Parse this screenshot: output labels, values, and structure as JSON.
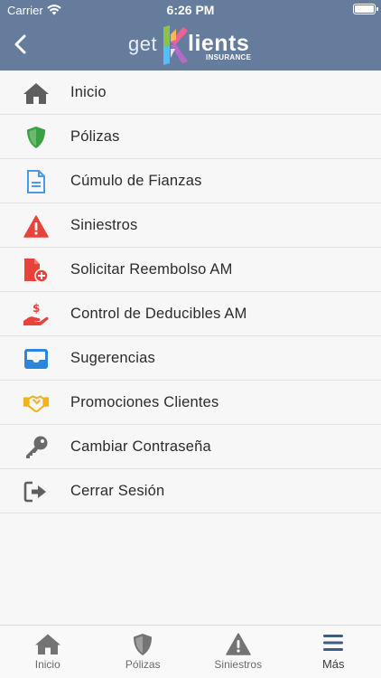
{
  "status_bar": {
    "carrier": "Carrier",
    "time": "6:26 PM"
  },
  "header": {
    "back_icon": "chevron-left-icon",
    "logo": {
      "prefix": "get",
      "brand": "lients",
      "tagline": "INSURANCE"
    }
  },
  "menu": {
    "items": [
      {
        "label": "Inicio",
        "icon": "home-icon",
        "color": "#5f5f5f"
      },
      {
        "label": "Pólizas",
        "icon": "shield-icon",
        "color": "#3aa142"
      },
      {
        "label": "Cúmulo de Fianzas",
        "icon": "document-icon",
        "color": "#4a9be3"
      },
      {
        "label": "Siniestros",
        "icon": "warning-icon",
        "color": "#e8433b"
      },
      {
        "label": "Solicitar Reembolso AM",
        "icon": "file-add-icon",
        "color": "#e8433b"
      },
      {
        "label": "Control de Deducibles AM",
        "icon": "hand-dollar-icon",
        "color": "#e8433b"
      },
      {
        "label": "Sugerencias",
        "icon": "inbox-icon",
        "color": "#2a86d8"
      },
      {
        "label": "Promociones Clientes",
        "icon": "handshake-icon",
        "color": "#f3b21b"
      },
      {
        "label": "Cambiar Contraseña",
        "icon": "key-icon",
        "color": "#5f5f5f"
      },
      {
        "label": "Cerrar Sesión",
        "icon": "sign-out-icon",
        "color": "#5f5f5f"
      }
    ]
  },
  "tab_bar": {
    "tabs": [
      {
        "label": "Inicio",
        "icon": "home-icon",
        "active": false
      },
      {
        "label": "Pólizas",
        "icon": "shield-icon",
        "active": false
      },
      {
        "label": "Siniestros",
        "icon": "warning-icon",
        "active": false
      },
      {
        "label": "Más",
        "icon": "menu-icon",
        "active": true
      }
    ]
  }
}
